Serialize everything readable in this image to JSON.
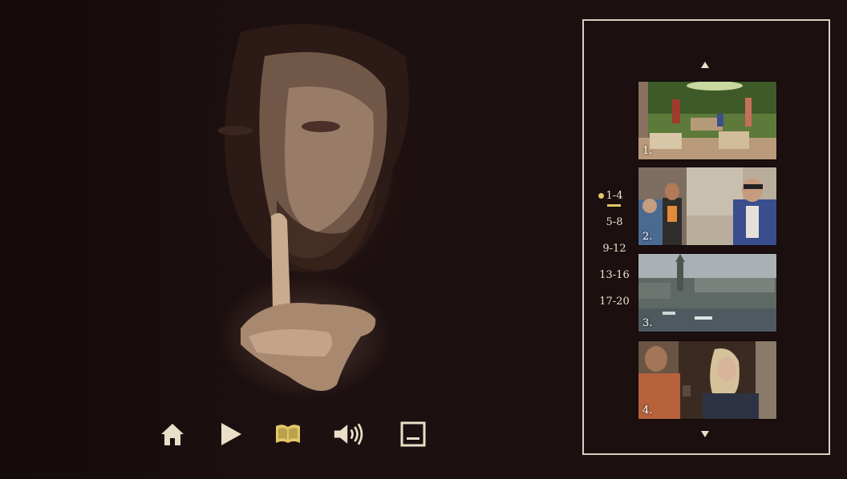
{
  "nav": {
    "items": [
      {
        "icon": "home-icon",
        "state": "normal"
      },
      {
        "icon": "play-icon",
        "state": "normal"
      },
      {
        "icon": "book-icon",
        "state": "active"
      },
      {
        "icon": "audio-icon",
        "state": "normal"
      },
      {
        "icon": "subtitles-icon",
        "state": "normal"
      }
    ],
    "active_color": "#e3c866",
    "normal_color": "#e9dfc8"
  },
  "chapters": {
    "pages": [
      {
        "label": "1-4",
        "active": true
      },
      {
        "label": "5-8",
        "active": false
      },
      {
        "label": "9-12",
        "active": false
      },
      {
        "label": "13-16",
        "active": false
      },
      {
        "label": "17-20",
        "active": false
      }
    ],
    "thumbnails": [
      {
        "number": "1."
      },
      {
        "number": "2."
      },
      {
        "number": "3."
      },
      {
        "number": "4."
      }
    ]
  }
}
